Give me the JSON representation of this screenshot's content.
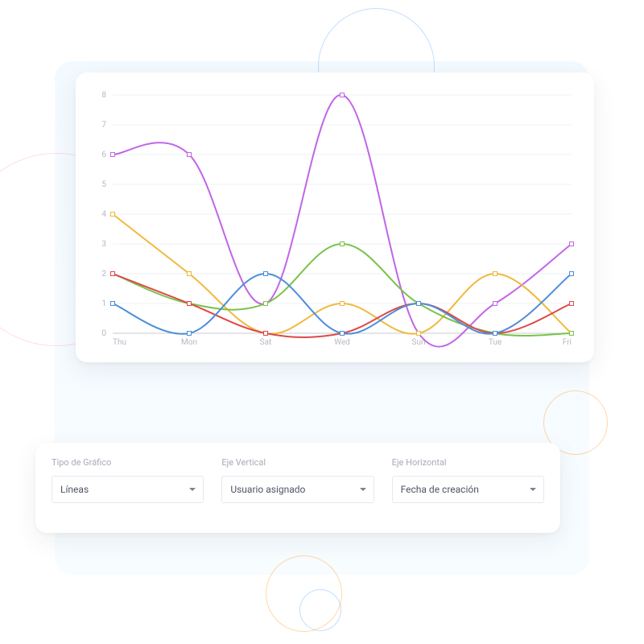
{
  "controls": {
    "chart_type": {
      "label": "Tipo de Gráfico",
      "value": "Líneas"
    },
    "y_axis": {
      "label": "Eje Vertical",
      "value": "Usuario asignado"
    },
    "x_axis": {
      "label": "Eje Horizontal",
      "value": "Fecha de creación"
    }
  },
  "chart_data": {
    "type": "line",
    "categories": [
      "Thu",
      "Mon",
      "Sat",
      "Wed",
      "Sun",
      "Tue",
      "Fri"
    ],
    "y_ticks": [
      0,
      1,
      2,
      3,
      4,
      5,
      6,
      7,
      8
    ],
    "ylim": [
      0,
      8
    ],
    "xlabel": "",
    "ylabel": "",
    "grid": true,
    "colors": {
      "purple": "#c265e6",
      "yellow": "#f0b93a",
      "green": "#7ac24a",
      "red": "#e04848",
      "blue": "#4c8ed9"
    },
    "series": [
      {
        "name": "purple",
        "values": [
          6,
          6,
          1,
          8,
          0,
          1,
          3
        ]
      },
      {
        "name": "yellow",
        "values": [
          4,
          2,
          0,
          1,
          0,
          2,
          0
        ]
      },
      {
        "name": "green",
        "values": [
          2,
          1,
          1,
          3,
          1,
          0,
          0
        ]
      },
      {
        "name": "red",
        "values": [
          2,
          1,
          0,
          0,
          1,
          0,
          1
        ]
      },
      {
        "name": "blue",
        "values": [
          1,
          0,
          2,
          0,
          1,
          0,
          2
        ]
      }
    ]
  }
}
